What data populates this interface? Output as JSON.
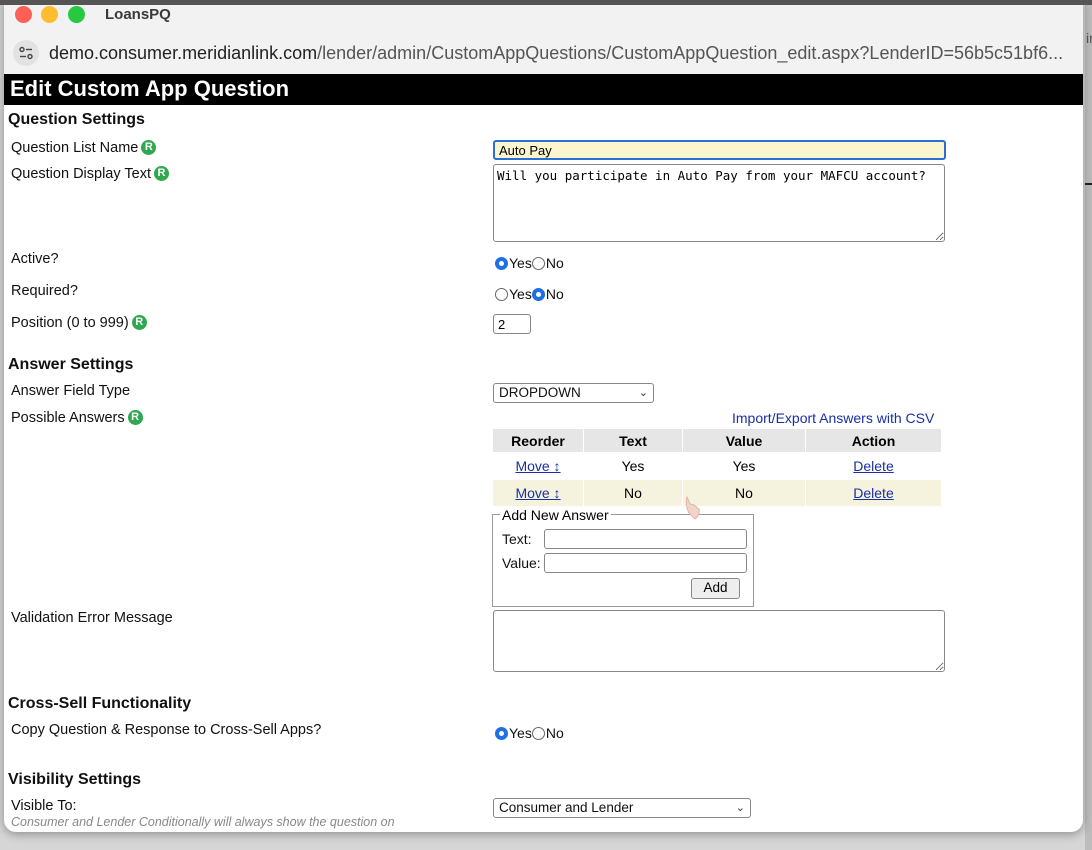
{
  "window": {
    "title": "LoansPQ"
  },
  "address_bar": {
    "url_host": "demo.consumer.meridianlink.com",
    "url_path": "/lender/admin/CustomAppQuestions/CustomAppQuestion_edit.aspx?LenderID=56b5c51bf6..."
  },
  "page": {
    "title": "Edit Custom App Question"
  },
  "question_settings": {
    "heading": "Question Settings",
    "list_name_label": "Question List Name",
    "list_name_value": "Auto Pay",
    "display_text_label": "Question Display Text",
    "display_text_value": "Will you participate in Auto Pay from your MAFCU account?",
    "active_label": "Active?",
    "active_value": "Yes",
    "required_label": "Required?",
    "required_value": "No",
    "position_label": "Position (0 to 999)",
    "position_value": "2",
    "required_badge": "R",
    "yes_label": "Yes",
    "no_label": "No"
  },
  "answer_settings": {
    "heading": "Answer Settings",
    "field_type_label": "Answer Field Type",
    "field_type_value": "DROPDOWN",
    "possible_answers_label": "Possible Answers",
    "import_export_link": "Import/Export Answers with CSV",
    "table_headers": [
      "Reorder",
      "Text",
      "Value",
      "Action"
    ],
    "rows": [
      {
        "move": "Move ↕",
        "text": "Yes",
        "value": "Yes",
        "action": "Delete"
      },
      {
        "move": "Move ↕",
        "text": "No",
        "value": "No",
        "action": "Delete"
      }
    ],
    "add_new": {
      "legend": "Add New Answer",
      "text_label": "Text:",
      "value_label": "Value:",
      "add_button": "Add"
    },
    "validation_label": "Validation Error Message",
    "validation_value": ""
  },
  "cross_sell": {
    "heading": "Cross-Sell Functionality",
    "copy_label": "Copy Question & Response to Cross-Sell Apps?",
    "copy_value": "Yes"
  },
  "visibility": {
    "heading": "Visibility Settings",
    "visible_to_label": "Visible To:",
    "visible_to_value": "Consumer and Lender",
    "hint": "Consumer and Lender Conditionally will always show the question on"
  },
  "icons": [
    "site-settings-icon",
    "required-badge-icon",
    "dropdown-chevron-icon",
    "mouse-cursor-icon"
  ]
}
